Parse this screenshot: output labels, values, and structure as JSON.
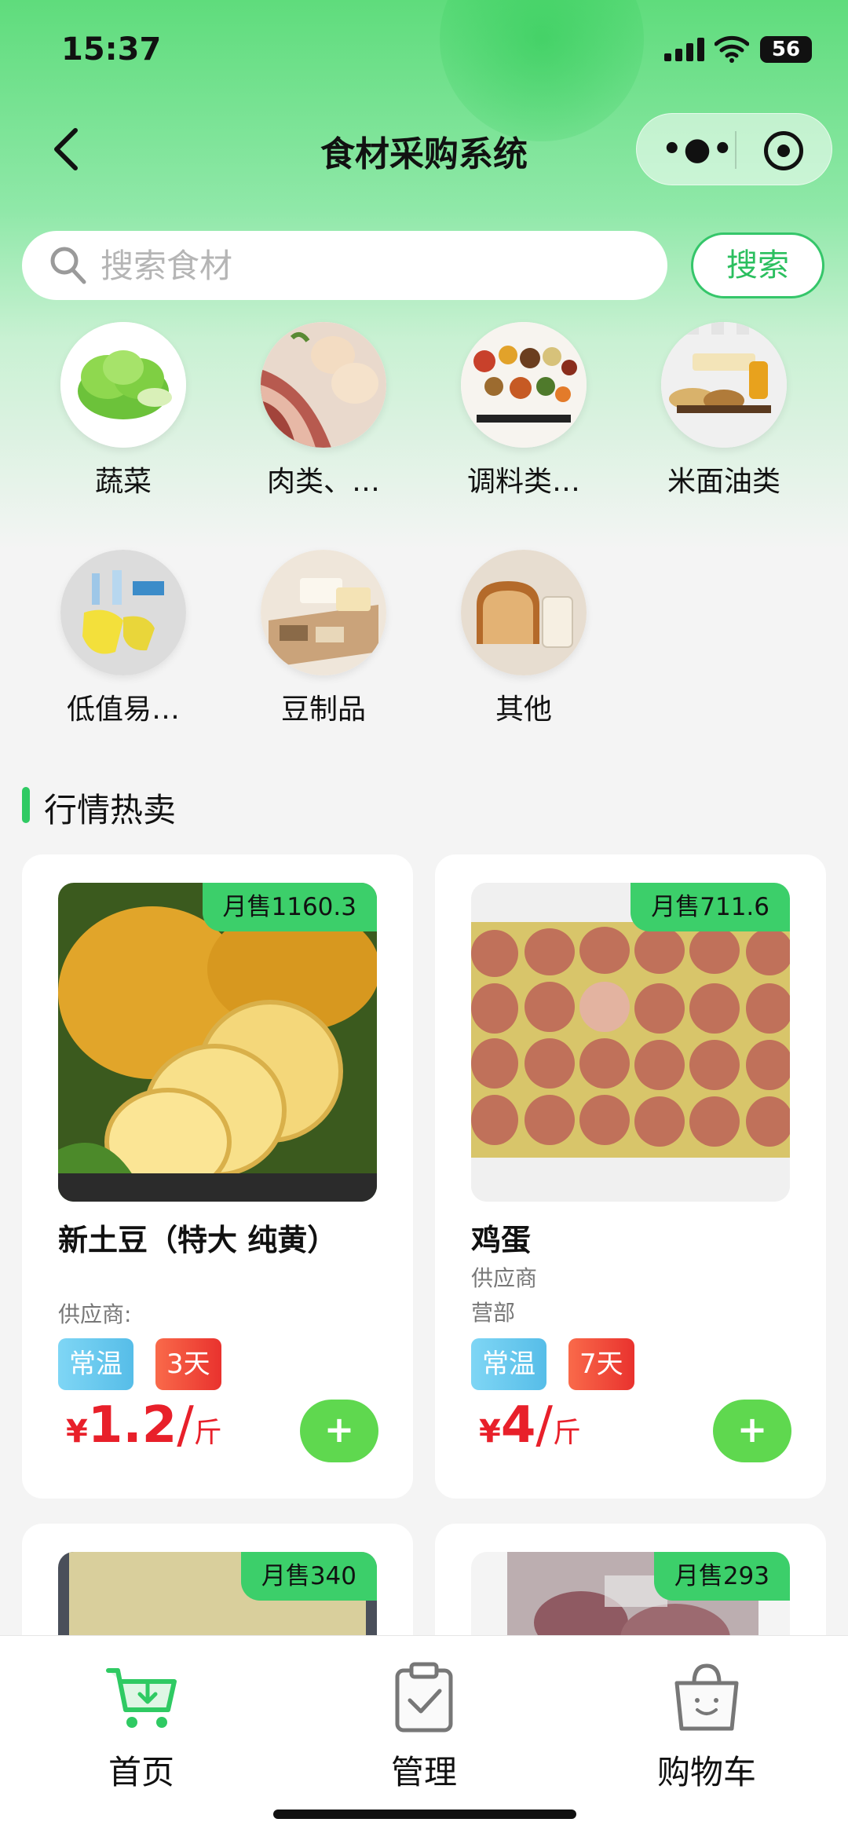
{
  "status_bar": {
    "time": "15:37",
    "battery": "56"
  },
  "nav": {
    "title": "食材采购系统"
  },
  "search": {
    "placeholder": "搜索食材",
    "button": "搜索"
  },
  "categories": [
    {
      "label": "蔬菜",
      "icon": "vegetable-image"
    },
    {
      "label": "肉类、…",
      "icon": "meat-egg-image"
    },
    {
      "label": "调料类…",
      "icon": "spice-image"
    },
    {
      "label": "米面油类",
      "icon": "rice-oil-image"
    },
    {
      "label": "低值易…",
      "icon": "supplies-image"
    },
    {
      "label": "豆制品",
      "icon": "tofu-image"
    },
    {
      "label": "其他",
      "icon": "bread-milk-image"
    }
  ],
  "section": {
    "title": "行情热卖"
  },
  "products": [
    {
      "sales": "月售1160.3",
      "name": "新土豆（特大 纯黄）",
      "supplier_line1": "供应商:",
      "supplier_line2": "",
      "storage": "常温",
      "shelf": "3天",
      "currency": "¥",
      "price": "1.2",
      "slash": "/",
      "unit": "斤",
      "add": "+"
    },
    {
      "sales": "月售711.6",
      "name": "鸡蛋",
      "supplier_line1": "供应商",
      "supplier_line2": "营部",
      "storage": "常温",
      "shelf": "7天",
      "currency": "¥",
      "price": "4",
      "slash": "/",
      "unit": "斤",
      "add": "+"
    },
    {
      "sales": "月售340"
    },
    {
      "sales": "月售293"
    }
  ],
  "tabbar": [
    {
      "label": "首页",
      "icon": "cart-download-icon",
      "active": true
    },
    {
      "label": "管理",
      "icon": "clipboard-check-icon",
      "active": false
    },
    {
      "label": "购物车",
      "icon": "shopping-bag-icon",
      "active": false
    }
  ],
  "colors": {
    "accent": "#2fca63",
    "price": "#e8202a",
    "add_button": "#5fd84f"
  }
}
